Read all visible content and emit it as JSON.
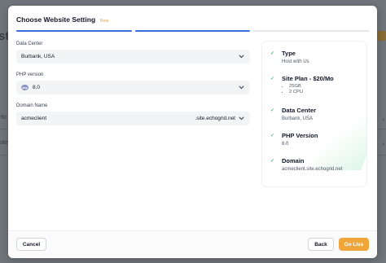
{
  "modal": {
    "title": "Choose Website Setting",
    "badge": "Beta",
    "steps_total": 3,
    "steps_completed": 2
  },
  "form": {
    "data_center": {
      "label": "Data Center",
      "value": "Burbank, USA"
    },
    "php_version": {
      "label": "PHP version",
      "value": "8.0",
      "icon": "php-icon"
    },
    "domain_name": {
      "label": "Domain Name",
      "value": "acmeclient",
      "suffix": ".site.echogrid.net"
    }
  },
  "summary": {
    "type": {
      "title": "Type",
      "value": "Host with Us"
    },
    "site_plan": {
      "title": "Site Plan - $20/Mo",
      "features": [
        "25GB",
        "2 CPU"
      ]
    },
    "data_center": {
      "title": "Data Center",
      "value": "Burbank, USA"
    },
    "php_version": {
      "title": "PHP Version",
      "value": "8.0"
    },
    "domain": {
      "title": "Domain",
      "value": "acmeclient.site.echogrid.net"
    }
  },
  "footer": {
    "cancel_label": "Cancel",
    "back_label": "Back",
    "go_live_label": "Go Live"
  },
  "background": {
    "left_letter": "st",
    "row1_text": "rfic",
    "row2_text": "site"
  },
  "colors": {
    "accent": "#3b6fd4",
    "primary_button": "#f0a53b",
    "check": "#16a34a",
    "beta": "#e6a23c"
  }
}
